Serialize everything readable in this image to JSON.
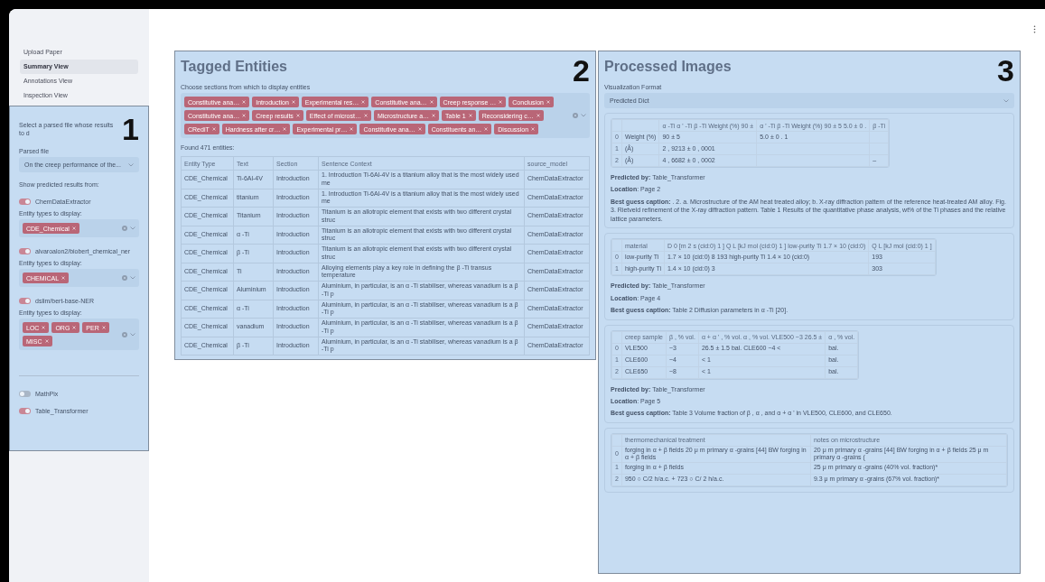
{
  "sidebar": {
    "nav": [
      {
        "label": "Upload Paper",
        "selected": false
      },
      {
        "label": "Summary View",
        "selected": true
      },
      {
        "label": "Annotations View",
        "selected": false
      },
      {
        "label": "Inspection View",
        "selected": false
      }
    ],
    "panel": {
      "marker": "1",
      "intro": "Select a parsed file whose results to d",
      "parsed_file": {
        "label": "Parsed file",
        "value": "On the creep performance of the..."
      },
      "show_label": "Show predicted results from:",
      "models": [
        {
          "name": "ChemDataExtractor",
          "on": true,
          "types_label": "Entity types to display:",
          "types": [
            "CDE_Chemical"
          ]
        },
        {
          "name": "alvaroalon2/biobert_chemical_ner",
          "on": true,
          "types_label": "Entity types to display:",
          "types": [
            "CHEMICAL"
          ]
        },
        {
          "name": "dslim/bert-base-NER",
          "on": true,
          "types_label": "Entity types to display:",
          "types": [
            "LOC",
            "ORG",
            "PER",
            "MISC"
          ]
        }
      ],
      "extra_models": [
        {
          "name": "MathPix",
          "on": false
        },
        {
          "name": "Table_Transformer",
          "on": true
        }
      ]
    }
  },
  "tagged_entities": {
    "marker": "2",
    "title": "Tagged Entities",
    "sections_label": "Choose sections from which to display entities",
    "sections": [
      "Constitutive ana…",
      "Introduction",
      "Experimental res…",
      "Constitutive ana…",
      "Creep response …",
      "Conclusion",
      "Constitutive ana…",
      "Creep results",
      "Effect of microst…",
      "Microstructure a…",
      "Table 1",
      "Reconsidering c…",
      "CRediT",
      "Hardness after cr…",
      "Experimental pr…",
      "Constitutive ana…",
      "Constituents an…",
      "Discussion"
    ],
    "found": "Found 471 entities:",
    "table": {
      "columns": [
        "Entity Type",
        "Text",
        "Section",
        "Sentence Context",
        "source_model"
      ],
      "rows": [
        [
          "CDE_Chemical",
          "Ti-6Al-4V",
          "Introduction",
          "1. Introduction Ti-6Al-4V is a titanium alloy that is the most widely used me",
          "ChemDataExtractor"
        ],
        [
          "CDE_Chemical",
          "titanium",
          "Introduction",
          "1. Introduction Ti-6Al-4V is a titanium alloy that is the most widely used me",
          "ChemDataExtractor"
        ],
        [
          "CDE_Chemical",
          "Titanium",
          "Introduction",
          "Titanium is an allotropic element that exists with two different crystal struc",
          "ChemDataExtractor"
        ],
        [
          "CDE_Chemical",
          "α -Ti",
          "Introduction",
          "Titanium is an allotropic element that exists with two different crystal struc",
          "ChemDataExtractor"
        ],
        [
          "CDE_Chemical",
          "β -Ti",
          "Introduction",
          "Titanium is an allotropic element that exists with two different crystal struc",
          "ChemDataExtractor"
        ],
        [
          "CDE_Chemical",
          "Ti",
          "Introduction",
          "Alloying elements play a key role in defining the β -Ti transus temperature",
          "ChemDataExtractor"
        ],
        [
          "CDE_Chemical",
          "Aluminium",
          "Introduction",
          "Aluminium, in particular, is an α -Ti stabiliser, whereas vanadium is a β -Ti p",
          "ChemDataExtractor"
        ],
        [
          "CDE_Chemical",
          "α -Ti",
          "Introduction",
          "Aluminium, in particular, is an α -Ti stabiliser, whereas vanadium is a β -Ti p",
          "ChemDataExtractor"
        ],
        [
          "CDE_Chemical",
          "vanadium",
          "Introduction",
          "Aluminium, in particular, is an α -Ti stabiliser, whereas vanadium is a β -Ti p",
          "ChemDataExtractor"
        ],
        [
          "CDE_Chemical",
          "β -Ti",
          "Introduction",
          "Aluminium, in particular, is an α -Ti stabiliser, whereas vanadium is a β -Ti p",
          "ChemDataExtractor"
        ]
      ]
    }
  },
  "processed_images": {
    "marker": "3",
    "title": "Processed Images",
    "format_label": "Visualization Format",
    "format_value": "Predicted Dict",
    "cards": [
      {
        "table": {
          "columns": [
            null,
            "α -Ti α ' -Ti β -Ti Weight (%) 90 ±",
            "α ' -Ti β -Ti Weight (%) 90 ± 5 5.0 ± 0 .",
            "β -Ti"
          ],
          "rows": [
            {
              "index": "0",
              "cells": [
                "Weight (%)",
                "90 ± 5",
                "5.0 ± 0 . 1",
                null
              ]
            },
            {
              "index": "1",
              "cells": [
                "(Å)",
                "2 , 9213 ± 0 , 0001",
                null,
                null
              ]
            },
            {
              "index": "2",
              "cells": [
                "(Å)",
                "4 , 6682 ± 0 , 0002",
                null,
                "–"
              ]
            }
          ]
        },
        "meta": [
          "**Predicted by:** Table_Transformer",
          "**Location**: Page 2",
          "**Best guess caption:** . 2. a. Microstructure of the AM heat treated alloy; b. X-ray diffraction pattern of the reference heat-treated AM alloy. Fig. 3. Rietveld refinement of the X-ray diffraction pattern. Table 1 Results of the quantitative phase analysis, wt% of the Ti phases and the relative lattice parameters."
        ]
      },
      {
        "table": {
          "columns": [
            "material",
            "D 0 [m 2 s (cid:0) 1 ] Q L [kJ mol (cid:0) 1 ] low-purity Ti 1.7 × 10 (cid:0)",
            "Q L [kJ mol (cid:0) 1 ]"
          ],
          "rows": [
            {
              "index": "0",
              "cells": [
                "low-purity Ti",
                "1.7 × 10 (cid:0) 8 193 high-purity Ti 1.4 × 10 (cid:0)",
                "193"
              ]
            },
            {
              "index": "1",
              "cells": [
                "high-purity Ti",
                "1.4 × 10 (cid:0) 3",
                "303"
              ]
            }
          ]
        },
        "meta": [
          "**Predicted by:** Table_Transformer",
          "**Location**: Page 4",
          "**Best guess caption:** Table 2 Diffusion parameters in α -Ti [20]."
        ]
      },
      {
        "table": {
          "columns": [
            "creep sample",
            "β , % vol.",
            "α + α ' , % vol. α , % vol. VLE500 ~3 26.5 ±",
            "α , % vol."
          ],
          "rows": [
            {
              "index": "0",
              "cells": [
                "VLE500",
                "~3",
                "26.5 ± 1.5 bal. CLE600 ~4 <",
                "bal."
              ]
            },
            {
              "index": "1",
              "cells": [
                "CLE600",
                "~4",
                "< 1",
                "bal."
              ]
            },
            {
              "index": "2",
              "cells": [
                "CLE650",
                "~8",
                "< 1",
                "bal."
              ]
            }
          ]
        },
        "meta": [
          "**Predicted by:** Table_Transformer",
          "**Location**: Page 5",
          "**Best guess caption:** Table 3 Volume fraction of β , α , and α + α ' in VLE500, CLE600, and CLE650."
        ]
      },
      {
        "table": {
          "columns": [
            "thermomechanical treatment",
            "notes on microstructure"
          ],
          "rows": [
            {
              "index": "0",
              "cells": [
                "forging in α + β fields 20 μ m primary α -grains [44] BW forging in α + β fields",
                "20 μ m primary α -grains [44] BW forging in α + β fields 25 μ m primary α -grains ("
              ]
            },
            {
              "index": "1",
              "cells": [
                "forging in α + β fields",
                "25 μ m primary α -grains (40% vol. fraction)*"
              ]
            },
            {
              "index": "2",
              "cells": [
                "950 ○ C/2 h/a.c. + 723 ○ C/ 2 h/a.c.",
                "9.3 μ m primary α -grains (67% vol. fraction)*"
              ]
            }
          ]
        }
      }
    ]
  }
}
